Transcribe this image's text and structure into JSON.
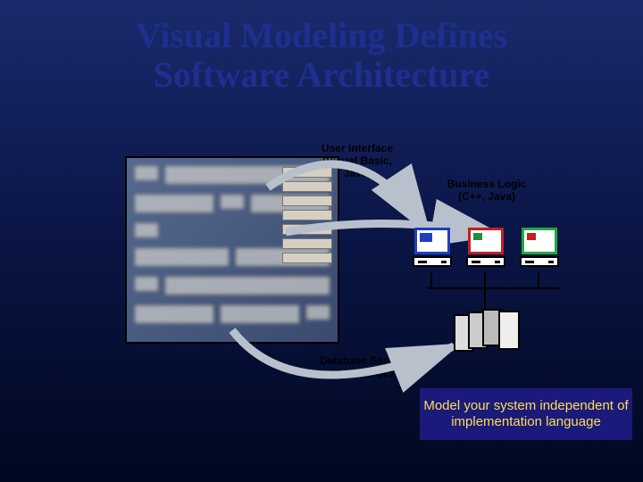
{
  "title_line1": "Visual Modeling Defines",
  "title_line2": "Software Architecture",
  "labels": {
    "ui_line1": "User Interface",
    "ui_line2": "(Visual Basic,",
    "ui_line3": "Java)",
    "bl_line1": "Business Logic",
    "bl_line2": "(C++, Java)",
    "db_line1": "Database Server",
    "db_line2": "(C++ & SQL)"
  },
  "callout": "Model your system independent of implementation language",
  "colors": {
    "title": "#1e2f8f",
    "callout_bg": "#1a1a7a",
    "callout_text": "#ffdd55"
  }
}
